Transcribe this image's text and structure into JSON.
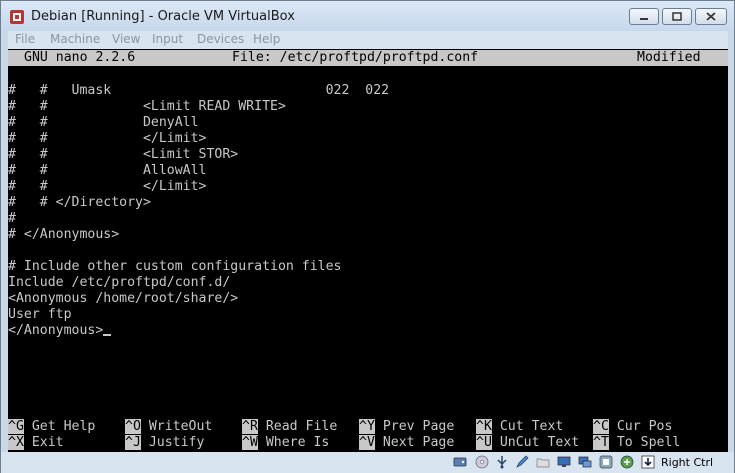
{
  "window": {
    "title": "Debian [Running] - Oracle VM VirtualBox",
    "accent": "#c9d9ea"
  },
  "menu": [
    "File",
    "Machine",
    "View",
    "Input",
    "Devices",
    "Help"
  ],
  "nano": {
    "version": "GNU nano 2.2.6",
    "file": "File: /etc/proftpd/proftpd.conf",
    "state": "Modified",
    "lines": [
      "#   #   Umask                           022  022",
      "#   #            <Limit READ WRITE>",
      "#   #            DenyAll",
      "#   #            </Limit>",
      "#   #            <Limit STOR>",
      "#   #            AllowAll",
      "#   #            </Limit>",
      "#   # </Directory>",
      "#",
      "# </Anonymous>",
      "",
      "# Include other custom configuration files",
      "Include /etc/proftpd/conf.d/",
      "<Anonymous /home/root/share/>",
      "User ftp",
      "</Anonymous>"
    ],
    "shortcuts_row1": [
      {
        "key": "^G",
        "label": "Get Help"
      },
      {
        "key": "^O",
        "label": "WriteOut"
      },
      {
        "key": "^R",
        "label": "Read File"
      },
      {
        "key": "^Y",
        "label": "Prev Page"
      },
      {
        "key": "^K",
        "label": "Cut Text"
      },
      {
        "key": "^C",
        "label": "Cur Pos"
      }
    ],
    "shortcuts_row2": [
      {
        "key": "^X",
        "label": "Exit"
      },
      {
        "key": "^J",
        "label": "Justify"
      },
      {
        "key": "^W",
        "label": "Where Is"
      },
      {
        "key": "^V",
        "label": "Next Page"
      },
      {
        "key": "^U",
        "label": "UnCut Text"
      },
      {
        "key": "^T",
        "label": "To Spell"
      }
    ]
  },
  "statusbar": {
    "host_key": "Right Ctrl",
    "icons": [
      "hdd-icon",
      "cd-icon",
      "usb-icon",
      "pen-icon",
      "shared-folder-icon",
      "folder-icon",
      "display-icon",
      "network-icon",
      "capture-icon",
      "arrow-down-icon"
    ]
  }
}
